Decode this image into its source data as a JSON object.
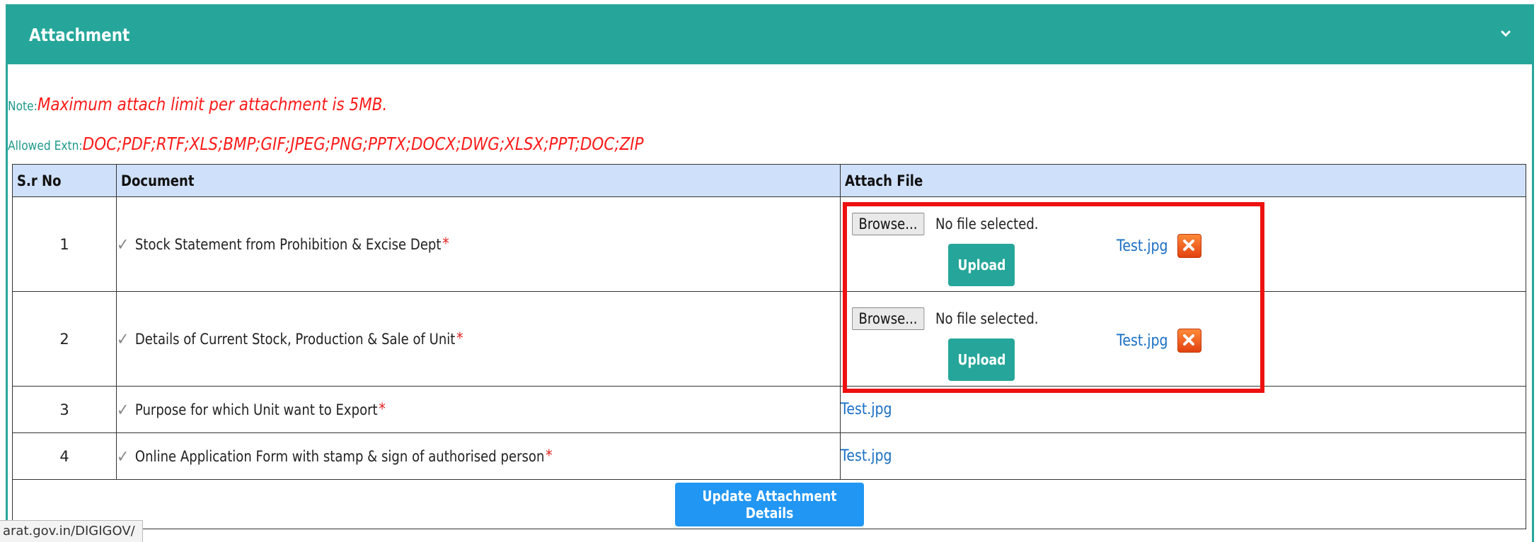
{
  "panel": {
    "title": "Attachment",
    "collapse_icon": "chevron-down-icon"
  },
  "notes": {
    "note_label": "Note:",
    "note_text": "Maximum attach limit per attachment is 5MB.",
    "extn_label": "Allowed Extn:",
    "extn_text": "DOC;PDF;RTF;XLS;BMP;GIF;JPEG;PNG;PPTX;DOCX;DWG;XLSX;PPT;DOC;ZIP"
  },
  "table": {
    "headers": [
      "S.r No",
      "Document",
      "Attach File"
    ],
    "rows": [
      {
        "sr": "1",
        "document": "Stock Statement from Prohibition & Excise Dept",
        "required": "*",
        "browse_label": "Browse...",
        "file_status": "No file selected.",
        "upload_label": "Upload",
        "file_link": "Test.jpg"
      },
      {
        "sr": "2",
        "document": "Details of Current Stock, Production & Sale of Unit",
        "required": "*",
        "browse_label": "Browse...",
        "file_status": "No file selected.",
        "upload_label": "Upload",
        "file_link": "Test.jpg"
      },
      {
        "sr": "3",
        "document": "Purpose for which Unit want to Export",
        "required": "*",
        "file_link": "Test.jpg"
      },
      {
        "sr": "4",
        "document": "Online Application Form with stamp & sign of authorised person",
        "required": "*",
        "file_link": "Test.jpg"
      }
    ],
    "update_button": "Update Attachment Details"
  },
  "status_bar": {
    "url": "arat.gov.in/DIGIGOV/"
  },
  "colors": {
    "header": "#26a69a",
    "note_text": "#ff1a1a",
    "table_header": "#cfe0fa",
    "update_button": "#2196f3",
    "highlight_box": "#ee1111"
  }
}
